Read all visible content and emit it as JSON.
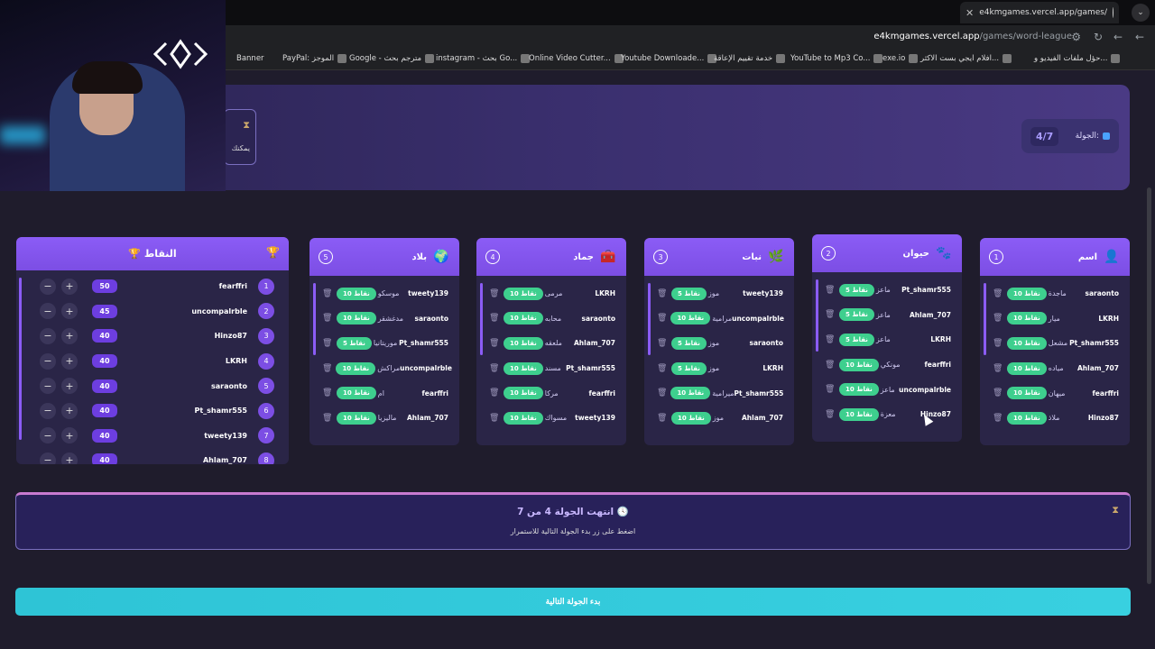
{
  "browser": {
    "tab_title": "e4kmgames.vercel.app/games/",
    "url_host": "e4kmgames.vercel.app",
    "url_path": "/games/word-league",
    "bookmarks": [
      "Banner",
      "PayPal: الموجز",
      "Google - مترجم بحث",
      "instagram - بحث Go...",
      "Online Video Cutter...",
      "Youtube Downloade...",
      "خدمة تقييم الإعاقة",
      "YouTube to Mp3 Co...",
      "exe.io",
      "افلام ايجي بست الاكثر...",
      "حؤل ملفات الفيديو و..."
    ]
  },
  "header": {
    "round_label": "الجولة:",
    "round_value": "4/7",
    "side_text": "يمكنك"
  },
  "categories": [
    {
      "num": "1",
      "title": "اسم",
      "icon": "person-icon",
      "rows": [
        {
          "word": "ماجدة",
          "pill": "10 نقاط",
          "player": "saraonto"
        },
        {
          "word": "ميار",
          "pill": "10 نقاط",
          "player": "LKRH"
        },
        {
          "word": "مشعل",
          "pill": "10 نقاط",
          "player": "Pt_shamr555"
        },
        {
          "word": "مياده",
          "pill": "10 نقاط",
          "player": "Ahlam_707"
        },
        {
          "word": "ميهان",
          "pill": "10 نقاط",
          "player": "fearffri"
        },
        {
          "word": "ملاذ",
          "pill": "10 نقاط",
          "player": "Hinzo87"
        }
      ]
    },
    {
      "num": "2",
      "title": "حيوان",
      "icon": "paw-icon",
      "rows": [
        {
          "word": "ماعز",
          "pill": "5 نقاط",
          "player": "Pt_shamr555"
        },
        {
          "word": "ماعز",
          "pill": "5 نقاط",
          "player": "Ahlam_707"
        },
        {
          "word": "ماعز",
          "pill": "5 نقاط",
          "player": "LKRH"
        },
        {
          "word": "مونكي",
          "pill": "10 نقاط",
          "player": "fearffri"
        },
        {
          "word": "ماعز",
          "pill": "10 نقاط",
          "player": "uncompalrble"
        },
        {
          "word": "معزة",
          "pill": "10 نقاط",
          "player": "Hinzo87"
        }
      ]
    },
    {
      "num": "3",
      "title": "نبات",
      "icon": "leaf-icon",
      "rows": [
        {
          "word": "موز",
          "pill": "5 نقاط",
          "player": "tweety139"
        },
        {
          "word": "مرامية",
          "pill": "10 نقاط",
          "player": "uncompalrble"
        },
        {
          "word": "موز",
          "pill": "5 نقاط",
          "player": "saraonto"
        },
        {
          "word": "موز",
          "pill": "5 نقاط",
          "player": "LKRH"
        },
        {
          "word": "ميرامية",
          "pill": "10 نقاط",
          "player": "Pt_shamr555"
        },
        {
          "word": "موز",
          "pill": "10 نقاط",
          "player": "Ahlam_707"
        }
      ]
    },
    {
      "num": "4",
      "title": "جماد",
      "icon": "toolbox-icon",
      "rows": [
        {
          "word": "مرمى",
          "pill": "10 نقاط",
          "player": "LKRH"
        },
        {
          "word": "محابه",
          "pill": "10 نقاط",
          "player": "saraonto"
        },
        {
          "word": "ملعقه",
          "pill": "10 نقاط",
          "player": "Ahlam_707"
        },
        {
          "word": "مسند",
          "pill": "10 نقاط",
          "player": "Pt_shamr555"
        },
        {
          "word": "مركا",
          "pill": "10 نقاط",
          "player": "fearffri"
        },
        {
          "word": "مسواك",
          "pill": "10 نقاط",
          "player": "tweety139"
        }
      ]
    },
    {
      "num": "5",
      "title": "بلاد",
      "icon": "globe-icon",
      "rows": [
        {
          "word": "موسكو",
          "pill": "10 نقاط",
          "player": "tweety139"
        },
        {
          "word": "مدغشقر",
          "pill": "10 نقاط",
          "player": "saraonto"
        },
        {
          "word": "موريتانيا",
          "pill": "5 نقاط",
          "player": "Pt_shamr555"
        },
        {
          "word": "مراكش",
          "pill": "10 نقاط",
          "player": "uncompalrble"
        },
        {
          "word": "ام",
          "pill": "10 نقاط",
          "player": "fearffri"
        },
        {
          "word": "ماليزيا",
          "pill": "10 نقاط",
          "player": "Ahlam_707"
        }
      ]
    }
  ],
  "scores": {
    "title": "النقاط",
    "rows": [
      {
        "rank": "1",
        "name": "fearffri",
        "points": "50"
      },
      {
        "rank": "2",
        "name": "uncompalrble",
        "points": "45"
      },
      {
        "rank": "3",
        "name": "Hinzo87",
        "points": "40"
      },
      {
        "rank": "4",
        "name": "LKRH",
        "points": "40"
      },
      {
        "rank": "5",
        "name": "saraonto",
        "points": "40"
      },
      {
        "rank": "6",
        "name": "Pt_shamr555",
        "points": "40"
      },
      {
        "rank": "7",
        "name": "tweety139",
        "points": "40"
      },
      {
        "rank": "8",
        "name": "Ahlam_707",
        "points": "40"
      }
    ],
    "minus": "−",
    "plus": "+"
  },
  "round_done": {
    "title": "انتهت الجولة 4 من 7",
    "subtitle": "اضغط على زر بدء الجولة التالية للاستمرار"
  },
  "next_button": "بدء الجولة التالية"
}
